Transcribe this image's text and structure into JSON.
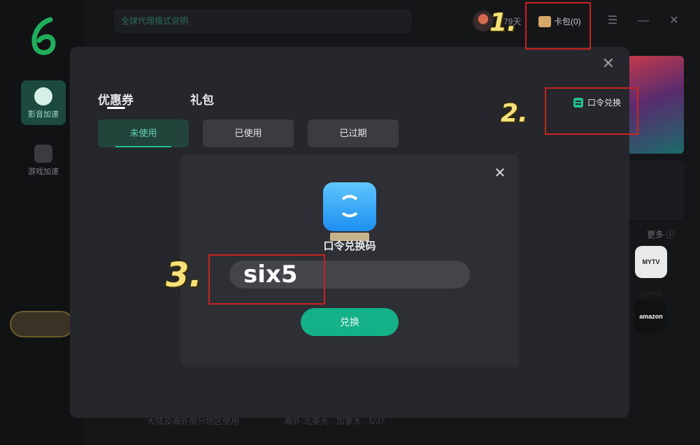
{
  "topbar": {
    "notice": "全球代理模式说明",
    "days": "79天",
    "wallet_label": "卡包(0)"
  },
  "sidebar": {
    "items": [
      {
        "label": "影音加速"
      },
      {
        "label": "游戏加速"
      }
    ]
  },
  "right_panel": {
    "more": "更多",
    "apps": [
      "MYTV SUPER",
      "amazon"
    ]
  },
  "modal": {
    "tabs": [
      "优惠券",
      "礼包"
    ],
    "filters": [
      "未使用",
      "已使用",
      "已过期"
    ],
    "redeem_link": "口令兑换"
  },
  "dialog": {
    "title": "口令兑换码",
    "code_value": "six5",
    "confirm_label": "兑换"
  },
  "annotations": {
    "step1": "1.",
    "step2": "2.",
    "step3": "3."
  },
  "bottom": {
    "left": "大陆及海外部分地区使用",
    "right": "海外·北美大 · 加拿大 · 5/37"
  },
  "colors": {
    "accent": "#22c08f",
    "annotation_box": "#c8231e",
    "annotation_text": "#f7e27a",
    "modal_bg": "#25272d"
  }
}
